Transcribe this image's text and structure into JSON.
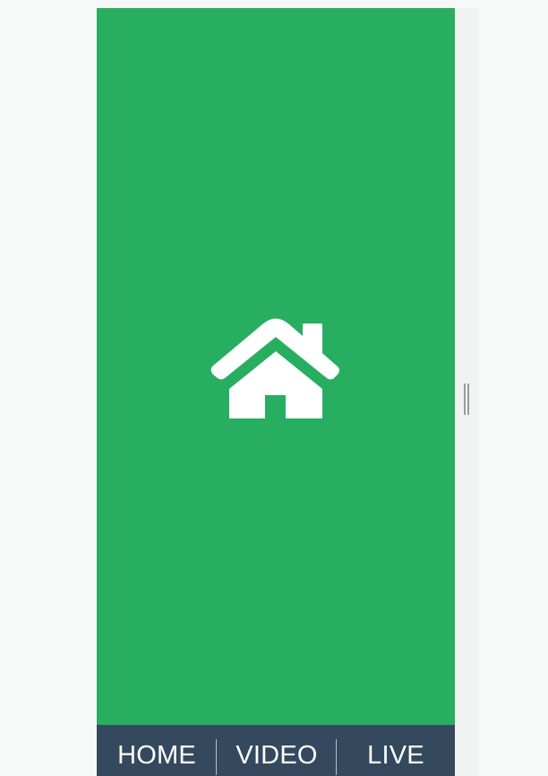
{
  "app": {
    "main_screen": {
      "icon": "home-icon",
      "background_color": "#27ae60"
    },
    "bottom_tabs": [
      {
        "label": "HOME"
      },
      {
        "label": "VIDEO"
      },
      {
        "label": "LIVE"
      }
    ],
    "colors": {
      "tab_bar_background": "#34495e",
      "tab_text": "#ffffff",
      "page_background": "#f7f9f9"
    }
  },
  "resize_handle": {
    "icon": "drag-handle-icon"
  }
}
